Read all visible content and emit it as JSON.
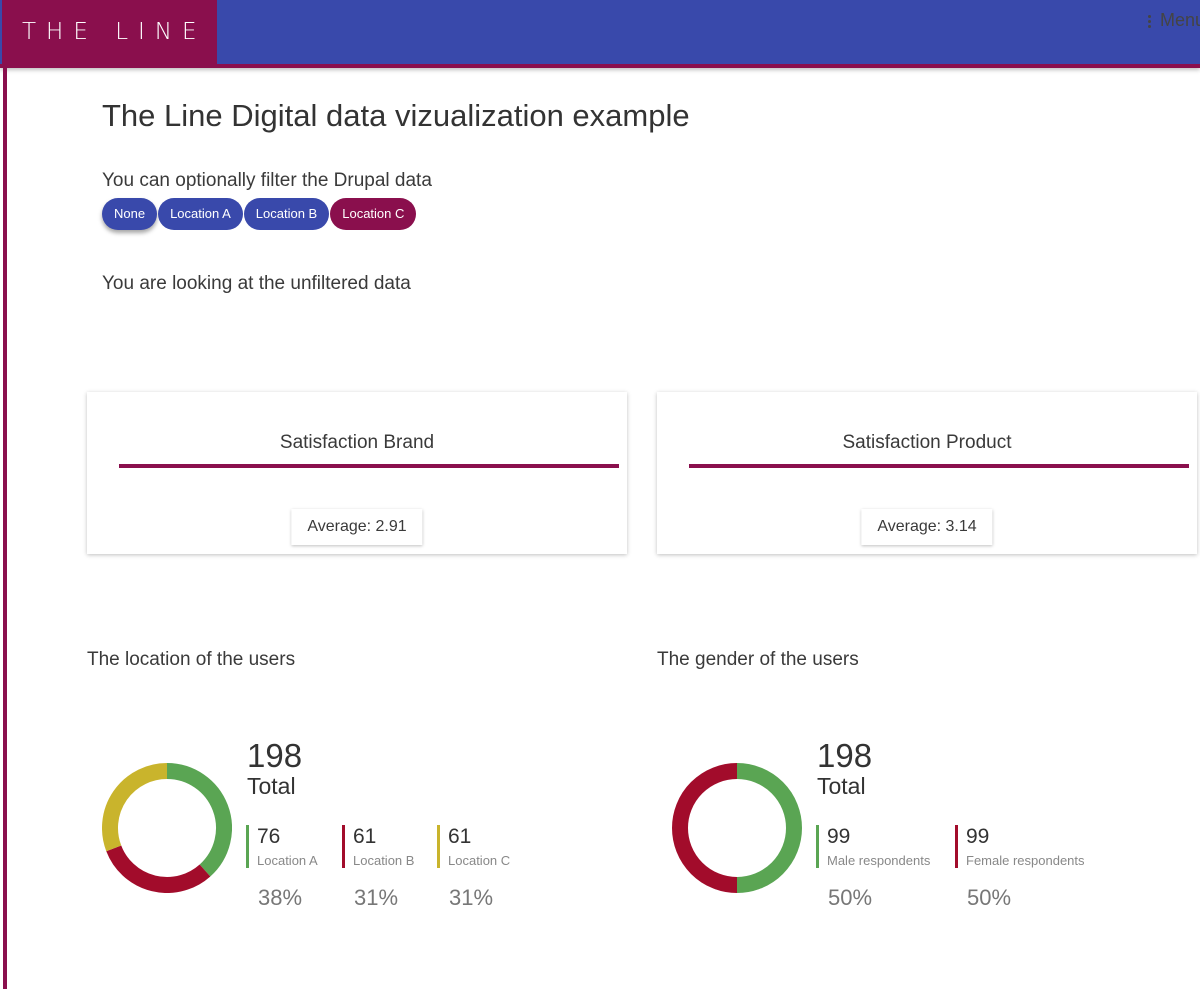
{
  "header": {
    "logo": "THE LINE",
    "menu_label": "Menu",
    "colors": {
      "primary": "#3949ab",
      "accent": "#8a0f4d"
    }
  },
  "page": {
    "title": "The Line Digital data vizualization example",
    "filter_prompt": "You can optionally filter the Drupal data",
    "filters": [
      {
        "label": "None"
      },
      {
        "label": "Location A"
      },
      {
        "label": "Location B"
      },
      {
        "label": "Location C",
        "selected": true
      }
    ],
    "status": "You are looking at the unfiltered data"
  },
  "cards": [
    {
      "title": "Satisfaction Brand",
      "average": "Average: 2.91"
    },
    {
      "title": "Satisfaction Product",
      "average": "Average: 3.14"
    }
  ],
  "charts": [
    {
      "title": "The location of the users",
      "total": "198",
      "total_label": "Total",
      "items": [
        {
          "value": "76",
          "label": "Location A",
          "pct": "38%",
          "color": "#5aa553"
        },
        {
          "value": "61",
          "label": "Location B",
          "pct": "31%",
          "color": "#a20c2b"
        },
        {
          "value": "61",
          "label": "Location C",
          "pct": "31%",
          "color": "#c9b42c"
        }
      ]
    },
    {
      "title": "The gender of the users",
      "total": "198",
      "total_label": "Total",
      "items": [
        {
          "value": "99",
          "label": "Male respondents",
          "pct": "50%",
          "color": "#5aa553"
        },
        {
          "value": "99",
          "label": "Female respondents",
          "pct": "50%",
          "color": "#a20c2b"
        }
      ]
    }
  ],
  "chart_data": [
    {
      "type": "pie",
      "title": "The location of the users",
      "categories": [
        "Location A",
        "Location B",
        "Location C"
      ],
      "values": [
        76,
        61,
        61
      ],
      "colors": [
        "#5aa553",
        "#a20c2b",
        "#c9b42c"
      ]
    },
    {
      "type": "pie",
      "title": "The gender of the users",
      "categories": [
        "Male respondents",
        "Female respondents"
      ],
      "values": [
        99,
        99
      ],
      "colors": [
        "#5aa553",
        "#a20c2b"
      ]
    }
  ]
}
